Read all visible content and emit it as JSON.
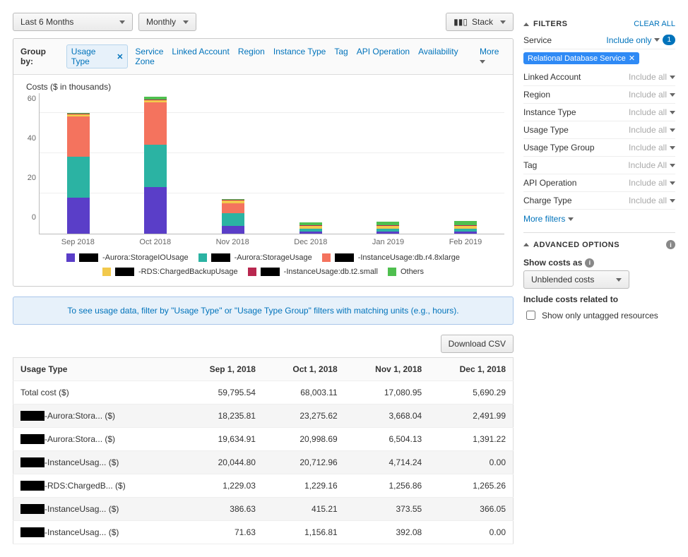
{
  "dropdowns": {
    "range": "Last 6 Months",
    "granularity": "Monthly",
    "stack": "Stack"
  },
  "groupby": {
    "label": "Group by:",
    "active": "Usage Type",
    "tabs": [
      "Service",
      "Linked Account",
      "Region",
      "Instance Type",
      "Tag",
      "API Operation",
      "Availability Zone"
    ],
    "more": "More"
  },
  "chart_data": {
    "type": "bar",
    "title": "Costs ($ in thousands)",
    "ylabel": "",
    "ylim": [
      0,
      70
    ],
    "yticks": [
      0,
      20,
      40,
      60
    ],
    "categories": [
      "Sep 2018",
      "Oct 2018",
      "Nov 2018",
      "Dec 2018",
      "Jan 2019",
      "Feb 2019"
    ],
    "series": [
      {
        "name": "-Aurora:StorageIOUsage",
        "color": "#5a3ec8",
        "values": [
          18,
          23,
          4,
          1,
          1,
          1
        ]
      },
      {
        "name": "-Aurora:StorageUsage",
        "color": "#2bb3a3",
        "values": [
          20,
          21,
          6,
          1.5,
          1.5,
          1.5
        ]
      },
      {
        "name": "-InstanceUsage:db.r4.8xlarge",
        "color": "#f4735e",
        "values": [
          20,
          21,
          5,
          0,
          0,
          0
        ]
      },
      {
        "name": "-RDS:ChargedBackupUsage",
        "color": "#f2c94c",
        "values": [
          1.2,
          1.2,
          1.3,
          1.3,
          1.3,
          1.3
        ]
      },
      {
        "name": "-InstanceUsage:db.t2.small",
        "color": "#b8274f",
        "values": [
          0.4,
          0.4,
          0.4,
          0.4,
          0.4,
          0.4
        ]
      },
      {
        "name": "Others",
        "color": "#4fbf4f",
        "values": [
          0.2,
          1.2,
          0.4,
          1.5,
          1.8,
          2.0
        ]
      }
    ]
  },
  "notice": "To see usage data, filter by \"Usage Type\" or \"Usage Type Group\" filters with matching units (e.g., hours).",
  "download": "Download CSV",
  "table": {
    "headers": [
      "Usage Type",
      "Sep 1, 2018",
      "Oct 1, 2018",
      "Nov 1, 2018",
      "Dec 1, 2018"
    ],
    "rows": [
      {
        "label": "Total cost ($)",
        "redact": false,
        "cells": [
          "59,795.54",
          "68,003.11",
          "17,080.95",
          "5,690.29"
        ]
      },
      {
        "label": "-Aurora:Stora... ($)",
        "redact": true,
        "cells": [
          "18,235.81",
          "23,275.62",
          "3,668.04",
          "2,491.99"
        ]
      },
      {
        "label": "-Aurora:Stora... ($)",
        "redact": true,
        "cells": [
          "19,634.91",
          "20,998.69",
          "6,504.13",
          "1,391.22"
        ]
      },
      {
        "label": "-InstanceUsag... ($)",
        "redact": true,
        "cells": [
          "20,044.80",
          "20,712.96",
          "4,714.24",
          "0.00"
        ]
      },
      {
        "label": "-RDS:ChargedB... ($)",
        "redact": true,
        "cells": [
          "1,229.03",
          "1,229.16",
          "1,256.86",
          "1,265.26"
        ]
      },
      {
        "label": "-InstanceUsag... ($)",
        "redact": true,
        "cells": [
          "386.63",
          "415.21",
          "373.55",
          "366.05"
        ]
      },
      {
        "label": "-InstanceUsag... ($)",
        "redact": true,
        "cells": [
          "71.63",
          "1,156.81",
          "392.08",
          "0.00"
        ]
      }
    ]
  },
  "filters": {
    "title": "FILTERS",
    "clear": "CLEAR ALL",
    "rows": [
      {
        "name": "Service",
        "val": "Include only",
        "active": true,
        "badge": "1"
      },
      {
        "name": "Linked Account",
        "val": "Include all"
      },
      {
        "name": "Region",
        "val": "Include all"
      },
      {
        "name": "Instance Type",
        "val": "Include all"
      },
      {
        "name": "Usage Type",
        "val": "Include all"
      },
      {
        "name": "Usage Type Group",
        "val": "Include all"
      },
      {
        "name": "Tag",
        "val": "Include All"
      },
      {
        "name": "API Operation",
        "val": "Include all"
      },
      {
        "name": "Charge Type",
        "val": "Include all"
      }
    ],
    "chip": "Relational Database Service",
    "morefilters": "More filters"
  },
  "advanced": {
    "title": "ADVANCED OPTIONS",
    "showcosts": "Show costs as",
    "unblended": "Unblended costs",
    "include": "Include costs related to",
    "untagged": "Show only untagged resources"
  }
}
